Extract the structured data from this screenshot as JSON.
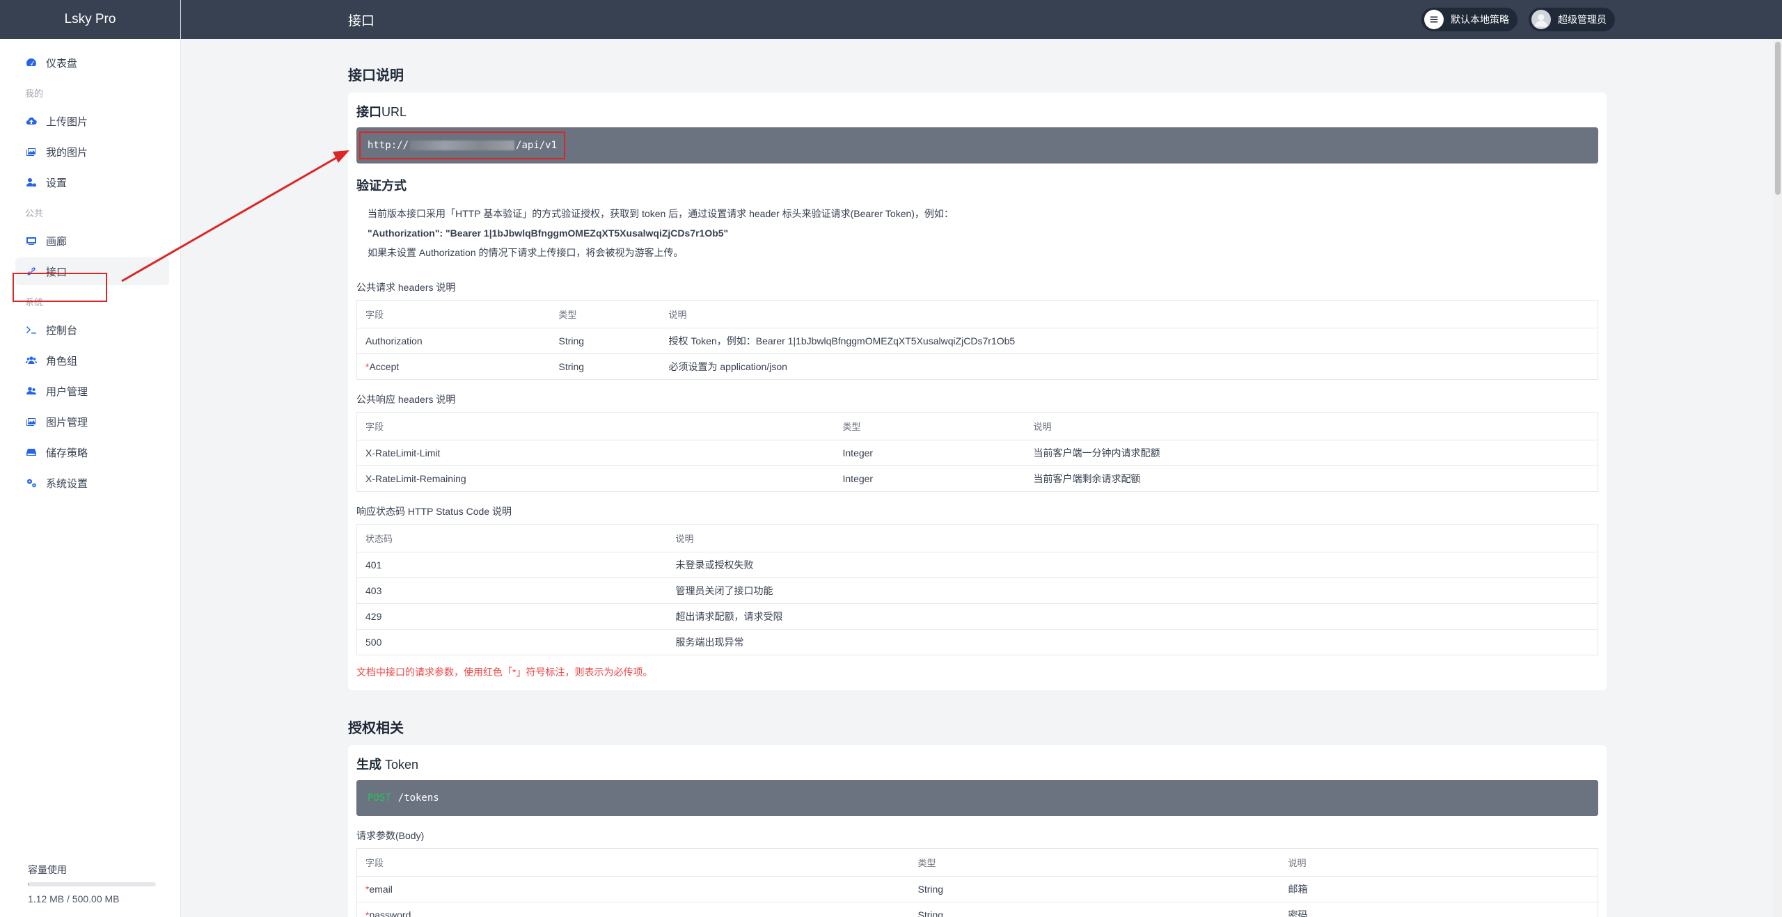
{
  "brand": "Lsky Pro",
  "topbar": {
    "title": "接口",
    "strategy_label": "默认本地策略",
    "user_label": "超级管理员"
  },
  "sidebar": {
    "dashboard": "仪表盘",
    "group_mine": "我的",
    "upload": "上传图片",
    "my_images": "我的图片",
    "settings": "设置",
    "group_public": "公共",
    "gallery": "画廊",
    "api": "接口",
    "group_system": "系统",
    "console": "控制台",
    "roles": "角色组",
    "users": "用户管理",
    "images": "图片管理",
    "storage": "储存策略",
    "system_settings": "系统设置",
    "usage_label": "容量使用",
    "usage_text": "1.12 MB / 500.00 MB",
    "usage_fraction": 0.0022
  },
  "api_doc": {
    "section_title": "接口说明",
    "url_title_bold": "接口",
    "url_title_rest": "URL",
    "url_prefix": "http://",
    "url_suffix": "/api/v1",
    "auth_title": "验证方式",
    "auth_line1": "当前版本接口采用「HTTP 基本验证」的方式验证授权，获取到 token 后，通过设置请求 header 标头来验证请求(Bearer Token)，例如：",
    "auth_line2": "\"Authorization\": \"Bearer 1|1bJbwlqBfnggmOMEZqXT5XusalwqiZjCDs7r1Ob5\"",
    "auth_line3": "如果未设置 Authorization 的情况下请求上传接口，将会被视为游客上传。",
    "req_headers_title": "公共请求 headers 说明",
    "req_headers_cols": [
      "字段",
      "类型",
      "说明"
    ],
    "req_headers_rows": [
      {
        "field": "Authorization",
        "required": "",
        "type": "String",
        "desc": "授权 Token，例如：Bearer 1|1bJbwlqBfnggmOMEZqXT5XusalwqiZjCDs7r1Ob5"
      },
      {
        "field": "Accept",
        "required": "*",
        "type": "String",
        "desc": "必须设置为 application/json"
      }
    ],
    "resp_headers_title": "公共响应 headers 说明",
    "resp_headers_cols": [
      "字段",
      "类型",
      "说明"
    ],
    "resp_headers_rows": [
      {
        "field": "X-RateLimit-Limit",
        "type": "Integer",
        "desc": "当前客户端一分钟内请求配额"
      },
      {
        "field": "X-RateLimit-Remaining",
        "type": "Integer",
        "desc": "当前客户端剩余请求配额"
      }
    ],
    "status_title": "响应状态码 HTTP Status Code 说明",
    "status_cols": [
      "状态码",
      "说明"
    ],
    "status_rows": [
      {
        "code": "401",
        "desc": "未登录或授权失败"
      },
      {
        "code": "403",
        "desc": "管理员关闭了接口功能"
      },
      {
        "code": "429",
        "desc": "超出请求配额，请求受限"
      },
      {
        "code": "500",
        "desc": "服务端出现异常"
      }
    ],
    "note": "文档中接口的请求参数，使用红色「*」符号标注，则表示为必传项。"
  },
  "auth_section": {
    "section_title": "授权相关",
    "gen_title_bold": "生成",
    "gen_title_rest": " Token",
    "method": "POST",
    "path": "/tokens",
    "body_title": "请求参数(Body)",
    "body_cols": [
      "字段",
      "类型",
      "说明"
    ],
    "body_rows": [
      {
        "field": "email",
        "required": "*",
        "type": "String",
        "desc": "邮箱"
      },
      {
        "field": "password",
        "required": "*",
        "type": "String",
        "desc": "密码"
      }
    ]
  },
  "colors": {
    "topbar": "#374151",
    "codebar": "#6b7280",
    "accent": "#2563eb",
    "highlight": "#dc2626"
  }
}
